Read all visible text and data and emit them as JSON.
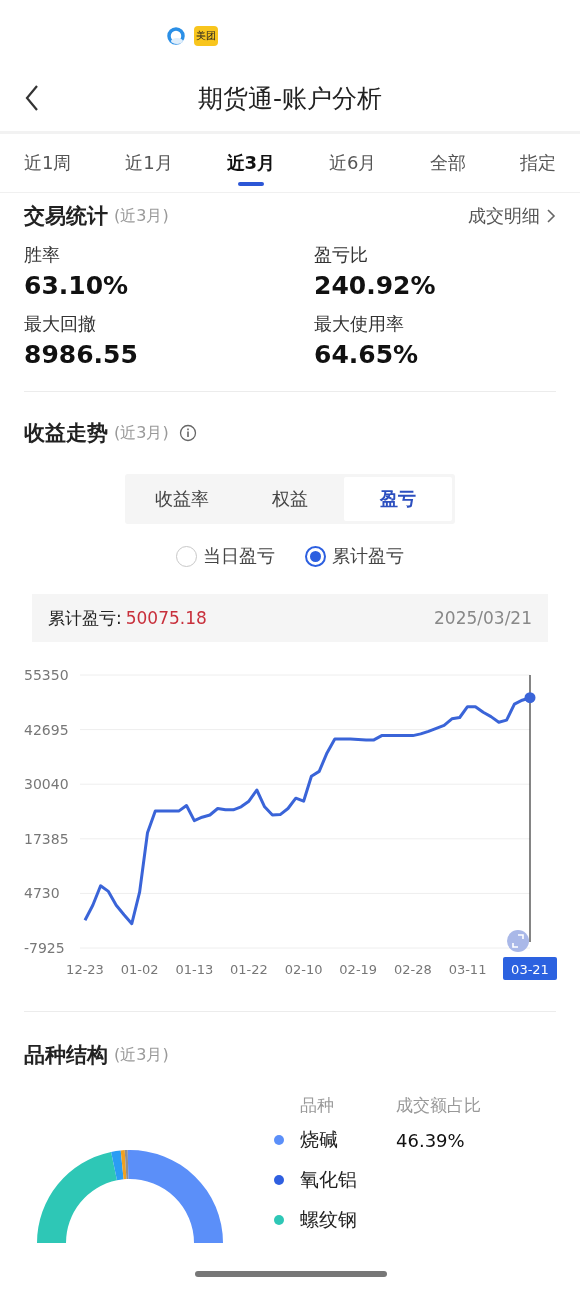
{
  "status_bar": {
    "app_icons": [
      {
        "kind": "browser"
      },
      {
        "kind": "meituan",
        "label": "美团"
      }
    ]
  },
  "nav": {
    "title": "期货通-账户分析"
  },
  "tabs": [
    {
      "label": "近1周",
      "selected": false
    },
    {
      "label": "近1月",
      "selected": false
    },
    {
      "label": "近3月",
      "selected": true
    },
    {
      "label": "近6月",
      "selected": false
    },
    {
      "label": "全部",
      "selected": false
    },
    {
      "label": "指定",
      "selected": false
    }
  ],
  "trade_stats": {
    "title": "交易统计",
    "period": "(近3月)",
    "link": "成交明细",
    "metrics": [
      {
        "label": "胜率",
        "value": "63.10%"
      },
      {
        "label": "盈亏比",
        "value": "240.92%"
      },
      {
        "label": "最大回撤",
        "value": "8986.55"
      },
      {
        "label": "最大使用率",
        "value": "64.65%"
      }
    ]
  },
  "profit_trend": {
    "title": "收益走势",
    "period": "(近3月)",
    "modes": [
      {
        "label": "收益率",
        "selected": false
      },
      {
        "label": "权益",
        "selected": false
      },
      {
        "label": "盈亏",
        "selected": true
      }
    ],
    "options": [
      {
        "label": "当日盈亏",
        "selected": false
      },
      {
        "label": "累计盈亏",
        "selected": true
      }
    ],
    "summary": {
      "label": "累计盈亏:",
      "value": "50075.18",
      "date": "2025/03/21"
    },
    "chart_data": {
      "type": "line",
      "grid": true,
      "categories": [
        "12-23",
        null,
        null,
        null,
        null,
        null,
        null,
        "01-02",
        null,
        null,
        null,
        null,
        null,
        null,
        "01-13",
        null,
        null,
        null,
        null,
        null,
        null,
        "01-22",
        null,
        null,
        null,
        null,
        null,
        null,
        "02-10",
        null,
        null,
        null,
        null,
        null,
        null,
        "02-19",
        null,
        null,
        null,
        null,
        null,
        null,
        "02-28",
        null,
        null,
        null,
        null,
        null,
        null,
        "03-11",
        null,
        null,
        null,
        null,
        null,
        null,
        null,
        "03-21"
      ],
      "ylim": [
        -7925,
        55350
      ],
      "yticks": [
        55350,
        42695,
        30040,
        17385,
        4730,
        -7925
      ],
      "series": [
        {
          "color": "#3a64d8",
          "values": [
            -1500,
            2000,
            6500,
            5200,
            2000,
            -200,
            -2300,
            5000,
            18800,
            23800,
            23800,
            23800,
            23800,
            25100,
            21600,
            22400,
            22900,
            24400,
            24100,
            24100,
            24800,
            26100,
            28700,
            24800,
            22900,
            23000,
            24400,
            26800,
            26100,
            31900,
            33000,
            37300,
            40500,
            40500,
            40500,
            40400,
            40300,
            40300,
            41300,
            41300,
            41300,
            41300,
            41300,
            41700,
            42300,
            43000,
            43700,
            45200,
            45500,
            48000,
            48000,
            46700,
            45700,
            44400,
            44900,
            48600,
            49500,
            50100
          ]
        }
      ]
    }
  },
  "variety_structure": {
    "title": "品种结构",
    "period": "(近3月)",
    "columns": [
      "品种",
      "成交额占比"
    ],
    "rows": [
      {
        "name": "烧碱",
        "color": "#5b8ff9",
        "ratio": "46.39%"
      },
      {
        "name": "氧化铝",
        "color": "#2f5fe0"
      },
      {
        "name": "螺纹钢",
        "color": "#2ec7b6"
      }
    ]
  }
}
